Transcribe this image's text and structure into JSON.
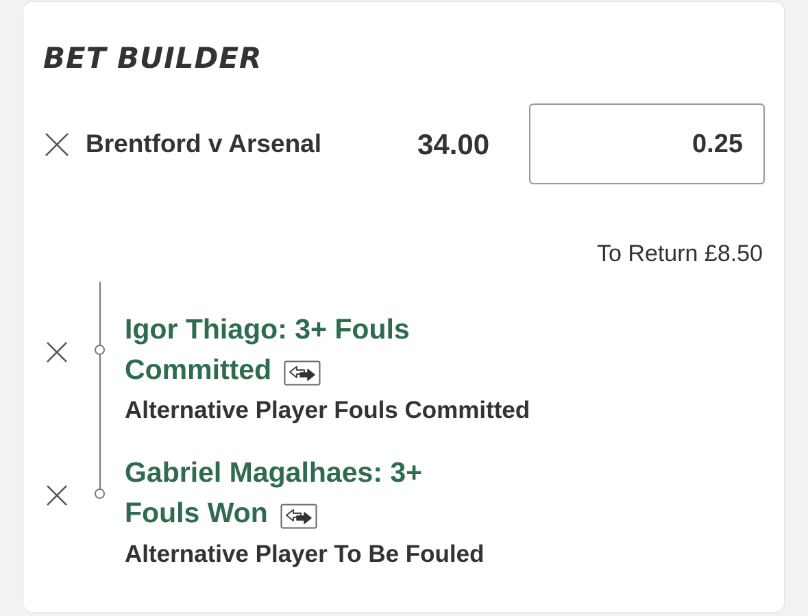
{
  "header": {
    "title": "BET BUILDER"
  },
  "bet": {
    "match": "Brentford v Arsenal",
    "odds": "34.00",
    "stake": "0.25",
    "to_return_label": "To Return",
    "to_return_value": "£8.50"
  },
  "selections": [
    {
      "name_line1": "Igor Thiago: 3+ Fouls",
      "name_line2": "Committed",
      "market": "Alternative Player Fouls Committed",
      "swap_icon": "swap-arrows-icon"
    },
    {
      "name_line1": "Gabriel Magalhaes: 3+",
      "name_line2": "Fouls Won",
      "market": "Alternative Player To Be Fouled",
      "swap_icon": "swap-arrows-icon"
    }
  ],
  "colors": {
    "selection_green": "#2e6b4f",
    "text_dark": "#333333",
    "background": "#f2f2f2"
  }
}
